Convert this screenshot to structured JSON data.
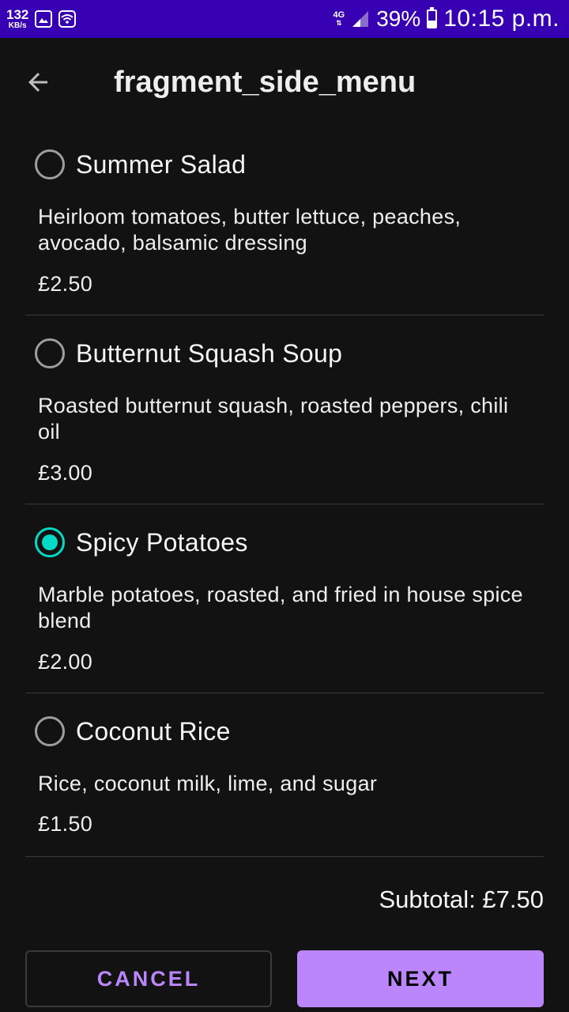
{
  "status_bar": {
    "net_speed_value": "132",
    "net_speed_unit": "KB/s",
    "network_type": "4G",
    "battery_percent": "39%",
    "time": "10:15 p.m."
  },
  "app_bar": {
    "title": "fragment_side_menu"
  },
  "menu": {
    "items": [
      {
        "name": "Summer Salad",
        "description": "Heirloom tomatoes, butter lettuce, peaches, avocado, balsamic dressing",
        "price": "£2.50",
        "selected": false
      },
      {
        "name": "Butternut Squash Soup",
        "description": "Roasted butternut squash, roasted peppers, chili oil",
        "price": "£3.00",
        "selected": false
      },
      {
        "name": "Spicy Potatoes",
        "description": "Marble potatoes, roasted, and fried in house spice blend",
        "price": "£2.00",
        "selected": true
      },
      {
        "name": "Coconut Rice",
        "description": "Rice, coconut milk, lime, and sugar",
        "price": "£1.50",
        "selected": false
      }
    ]
  },
  "subtotal": "Subtotal: £7.50",
  "buttons": {
    "cancel": "CANCEL",
    "next": "NEXT"
  },
  "colors": {
    "status_bar": "#3700b3",
    "background": "#121212",
    "accent": "#03dac5",
    "primary": "#bb86fc"
  },
  "icons": {
    "back": "arrow-back-icon",
    "gallery": "image-icon",
    "wifi": "wifi-icon",
    "signal": "signal-icon",
    "battery": "battery-icon"
  }
}
